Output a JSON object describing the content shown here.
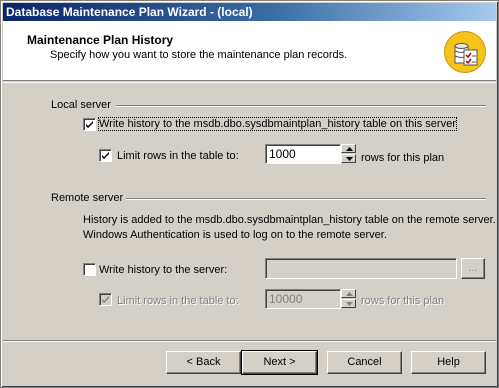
{
  "window": {
    "title": "Database Maintenance Plan Wizard - (local)"
  },
  "header": {
    "title": "Maintenance Plan History",
    "subtitle": "Specify how you want to store the maintenance plan records."
  },
  "local_server": {
    "group_label": "Local server",
    "write_history": {
      "label": "Write history to the msdb.dbo.sysdbmaintplan_history table on this server",
      "checked": true
    },
    "limit_rows": {
      "label": "Limit rows in the table to:",
      "checked": true,
      "value": "1000",
      "suffix": "rows for this plan"
    }
  },
  "remote_server": {
    "group_label": "Remote server",
    "info_line1": "History is added to the msdb.dbo.sysdbmaintplan_history table on the remote server.",
    "info_line2": "Windows Authentication is used to log on to the remote server.",
    "write_history": {
      "label": "Write history to the server:",
      "checked": false,
      "value": ""
    },
    "browse_label": "...",
    "limit_rows": {
      "label": "Limit rows in the table to:",
      "checked": true,
      "disabled": true,
      "value": "10000",
      "suffix": "rows for this plan"
    }
  },
  "buttons": {
    "back": "< Back",
    "next": "Next >",
    "cancel": "Cancel",
    "help": "Help"
  },
  "colors": {
    "title_bar": "#0a246a",
    "face": "#d4d0c8",
    "header_bg": "#ffffff",
    "icon": "#f6c21c"
  }
}
